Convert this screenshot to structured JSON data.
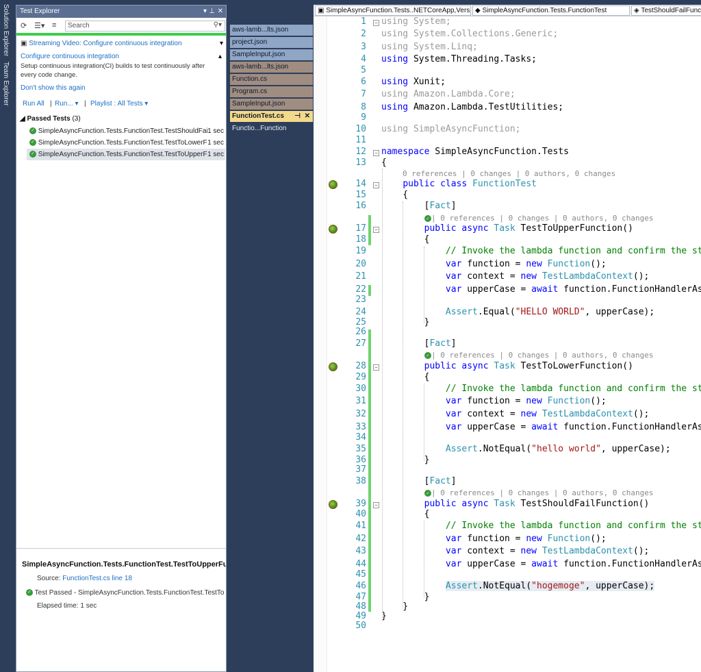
{
  "side_tabs": [
    "Solution Explorer",
    "Team Explorer"
  ],
  "test_explorer": {
    "title": "Test Explorer",
    "search_placeholder": "Search",
    "banner": {
      "video": "Streaming Video: Configure continuous integration",
      "heading": "Configure continuous integration",
      "body": "Setup continuous integration(CI) builds to test continuously after every code change.",
      "dismiss": "Don't show this again"
    },
    "actions": {
      "run_all": "Run All",
      "run": "Run...",
      "playlist": "Playlist : All Tests"
    },
    "group": {
      "label": "Passed Tests",
      "count": "(3)"
    },
    "tests": [
      {
        "name": "SimpleAsyncFunction.Tests.FunctionTest.TestShouldFail...",
        "duration": "1 sec"
      },
      {
        "name": "SimpleAsyncFunction.Tests.FunctionTest.TestToLowerFu...",
        "duration": "1 sec"
      },
      {
        "name": "SimpleAsyncFunction.Tests.FunctionTest.TestToUpperFu...",
        "duration": "1 sec"
      }
    ],
    "detail": {
      "title": "SimpleAsyncFunction.Tests.FunctionTest.TestToUpperFunc",
      "source_label": "Source:",
      "source_link": "FunctionTest.cs line 18",
      "result": "Test Passed - SimpleAsyncFunction.Tests.FunctionTest.TestToUp",
      "elapsed": "Elapsed time: 1 sec"
    }
  },
  "file_tabs": [
    "aws-lamb...lts.json",
    "project.json",
    "SampleInput.json",
    "aws-lamb...lts.json",
    "Function.cs",
    "Program.cs",
    "SampleInput.json",
    "FunctionTest.cs",
    "Functio...Function"
  ],
  "editor": {
    "nav": [
      "SimpleAsyncFunction.Tests..NETCoreApp,Versi",
      "SimpleAsyncFunction.Tests.FunctionTest",
      "TestShouldFailFunct"
    ],
    "lens_class": "0 references | 0 changes | 0 authors, 0 changes",
    "lens_method": "| 0 references | 0 changes | 0 authors, 0 changes",
    "comment": "// Invoke the lambda function and confirm the st"
  }
}
